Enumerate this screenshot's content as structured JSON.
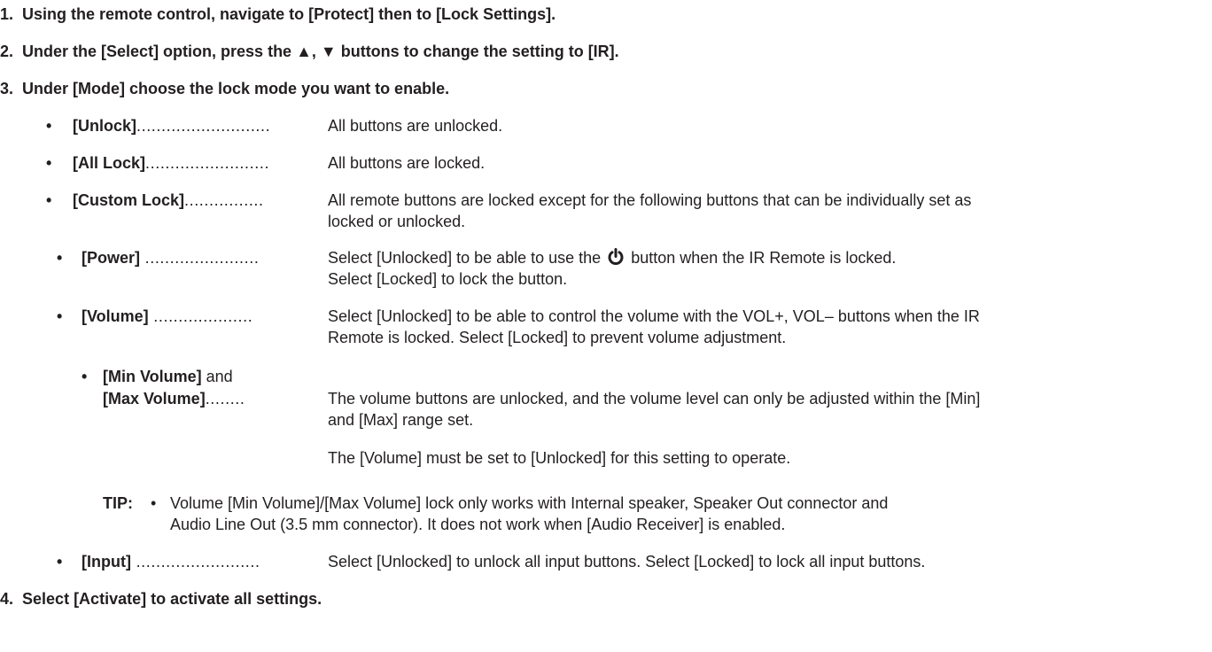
{
  "steps": [
    {
      "num": "1.",
      "text": "Using the remote control, navigate to [Protect] then to [Lock Settings]."
    },
    {
      "num": "2.",
      "text": "Under the [Select] option, press the ▲, ▼ buttons to change the setting to [IR]."
    },
    {
      "num": "3.",
      "text": "Under [Mode] choose the lock mode you want to enable."
    },
    {
      "num": "4.",
      "text": "Select [Activate] to activate all settings."
    }
  ],
  "bullet_glyph": "•",
  "modes": {
    "unlock": {
      "term": "[Unlock]",
      "dots": "...........................",
      "desc": "All buttons are unlocked."
    },
    "all_lock": {
      "term": "[All Lock]",
      "dots": ".........................",
      "desc": "All buttons are locked."
    },
    "custom_lock": {
      "term": "[Custom Lock]",
      "dots": "................",
      "desc_line1": "All remote buttons are locked except for the following buttons that can be individually set as",
      "desc_line2": "locked or unlocked."
    },
    "power": {
      "term": "[Power]",
      "dots": " .......................",
      "desc_line1_pre": "Select [Unlocked] to be able to use the",
      "desc_line1_post": "button when the IR Remote is locked.",
      "desc_line2": "Select [Locked] to lock the button."
    },
    "volume": {
      "term": "[Volume]",
      "dots": " ....................",
      "desc_line1": "Select [Unlocked] to be able to control the volume with the VOL+, VOL– buttons when the IR",
      "desc_line2": "Remote is locked. Select [Locked] to prevent volume adjustment."
    },
    "min_max": {
      "term1": "[Min Volume]",
      "and": " and",
      "term2": "[Max Volume]",
      "dots": "........",
      "desc_line1": "The volume buttons are unlocked, and the volume level can only be adjusted within the [Min]",
      "desc_line2": "and [Max] range set.",
      "note": "The [Volume] must be set to [Unlocked] for this setting to operate."
    },
    "input": {
      "term": "[Input]",
      "dots": " .........................",
      "desc": "Select [Unlocked] to unlock all input buttons. Select [Locked] to lock all input buttons."
    }
  },
  "tip": {
    "label": "TIP:",
    "bullet": "•",
    "line1": "Volume [Min Volume]/[Max Volume] lock only works with Internal speaker, Speaker Out connector and",
    "line2": "Audio Line Out (3.5 mm connector). It does not work when [Audio Receiver] is enabled."
  },
  "icons": {
    "power": "power-icon"
  }
}
